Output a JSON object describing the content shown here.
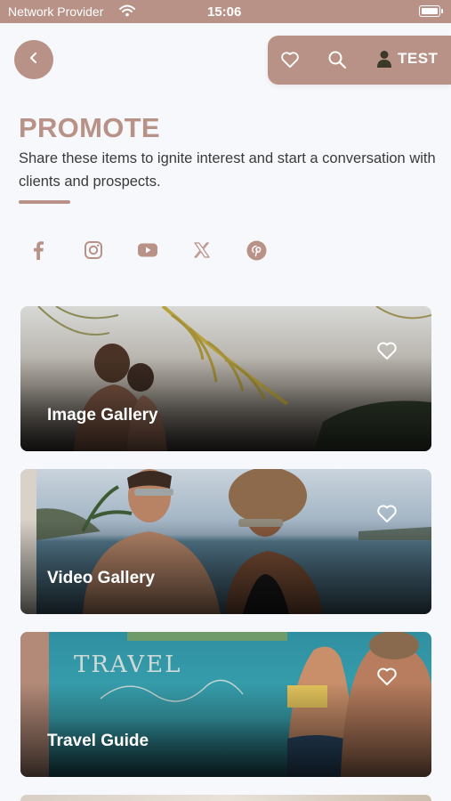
{
  "status_bar": {
    "carrier": "Network Provider",
    "time": "15:06",
    "wifi_icon": "wifi-icon",
    "battery_icon": "battery-icon"
  },
  "header": {
    "back_icon": "chevron-left-icon",
    "favorites_icon": "heart-icon",
    "search_icon": "search-icon",
    "user_icon": "user-icon",
    "user_label": "TEST"
  },
  "intro": {
    "title": "PROMOTE",
    "description": "Share these items to ignite interest and start a conversation with clients and prospects."
  },
  "social_links": [
    {
      "name": "facebook",
      "icon": "facebook-icon"
    },
    {
      "name": "instagram",
      "icon": "instagram-icon"
    },
    {
      "name": "youtube",
      "icon": "youtube-icon"
    },
    {
      "name": "x",
      "icon": "x-icon"
    },
    {
      "name": "pinterest",
      "icon": "pinterest-icon"
    }
  ],
  "cards": [
    {
      "label": "Image Gallery",
      "heart_icon": "heart-icon"
    },
    {
      "label": "Video Gallery",
      "heart_icon": "heart-icon"
    },
    {
      "label": "Travel Guide",
      "heart_icon": "heart-icon"
    }
  ],
  "colors": {
    "accent": "#b99287",
    "background": "#f7f8fb",
    "text": "#3a3a3a"
  }
}
